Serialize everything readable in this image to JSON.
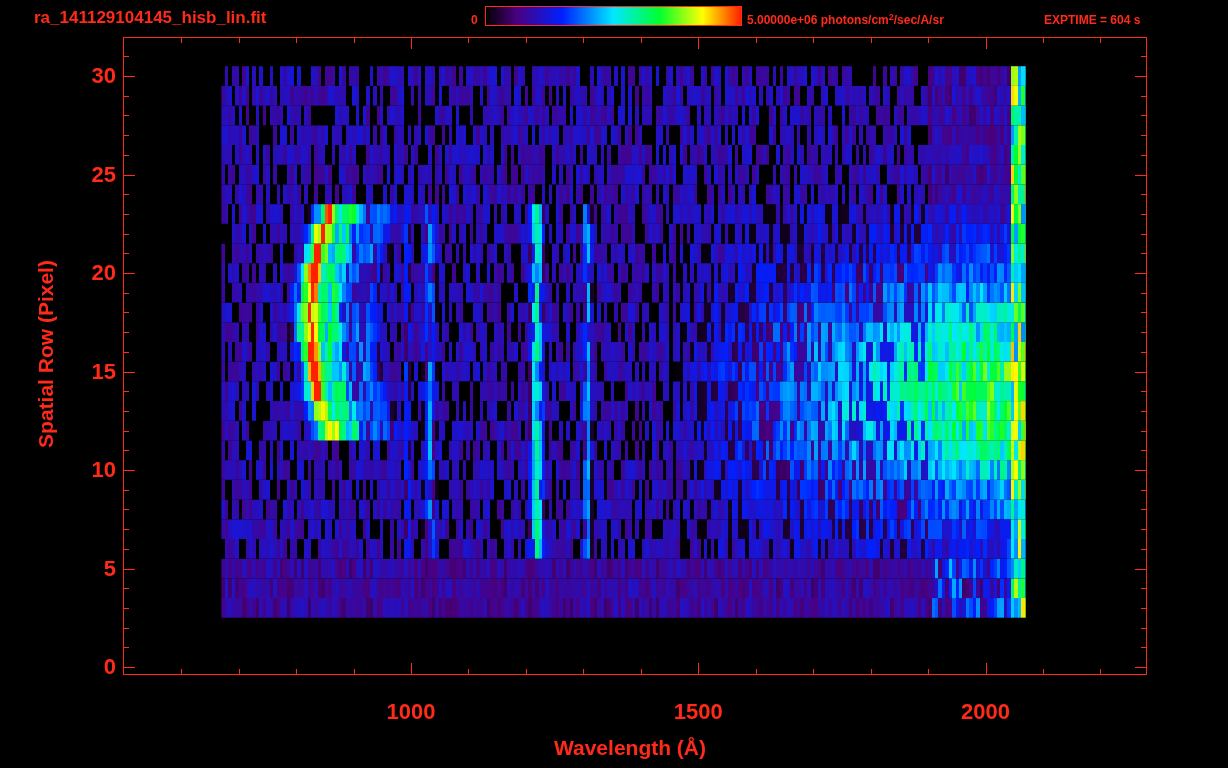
{
  "title": "ra_141129104145_hisb_lin.fit",
  "colorbar": {
    "min_label": "0",
    "max_label": "5.00000e+06 photons/cm$^{2}$/sec/A/sr"
  },
  "exposure": "EXPTIME = 604 s",
  "y_axis": {
    "title": "Spatial Row (Pixel)",
    "tick_labels": [
      "30",
      "25",
      "20",
      "15",
      "10",
      "5",
      "0"
    ]
  },
  "x_axis": {
    "title": "Wavelength (Å)",
    "tick_labels": [
      "1000",
      "1500",
      "2000"
    ]
  }
}
